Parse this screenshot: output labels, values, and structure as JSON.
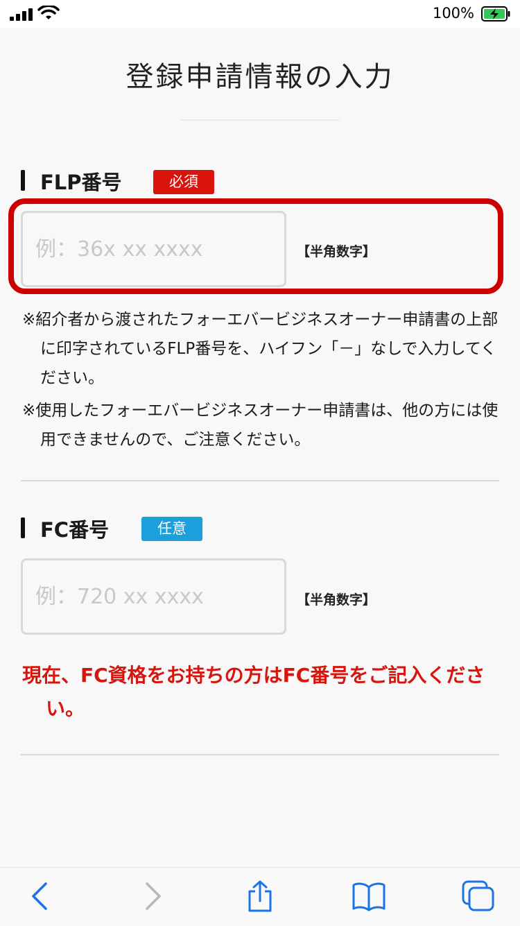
{
  "status_bar": {
    "battery_percent": "100%",
    "battery_color": "#34c759"
  },
  "page": {
    "title": "登録申請情報の入力"
  },
  "flp_section": {
    "title": "FLP番号",
    "badge": "必須",
    "badge_color": "#d9140d",
    "input_placeholder": "例：36x xx xxxx",
    "input_value": "",
    "hint": "【半角数字】",
    "notes": [
      "※紹介者から渡されたフォーエバービジネスオーナー申請書の上部に印字されているFLP番号を、ハイフン「－」なしで入力してください。",
      "※使用したフォーエバービジネスオーナー申請書は、他の方には使用できませんので、ご注意ください。"
    ]
  },
  "fc_section": {
    "title": "FC番号",
    "badge": "任意",
    "badge_color": "#1d9fdc",
    "input_placeholder": "例：720 xx xxxx",
    "input_value": "",
    "hint": "【半角数字】",
    "notice": "現在、FC資格をお持ちの方はFC番号をご記入ください。"
  },
  "toolbar": {
    "accent_color": "#1a73e8",
    "icons": [
      "back-icon",
      "forward-icon",
      "share-icon",
      "bookmarks-icon",
      "tabs-icon"
    ]
  }
}
